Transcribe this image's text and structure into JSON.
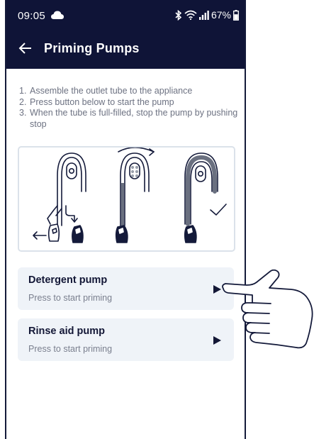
{
  "status_bar": {
    "time": "09:05",
    "battery": "67%",
    "icons": [
      "cloud-icon",
      "bluetooth-icon",
      "wifi-icon",
      "signal-icon",
      "battery-icon"
    ]
  },
  "header": {
    "title": "Priming Pumps",
    "back_icon": "back-arrow-icon"
  },
  "instructions": [
    {
      "num": "1.",
      "text": "Assemble the outlet tube to the appliance"
    },
    {
      "num": "2.",
      "text": "Press button below to start the pump"
    },
    {
      "num": "3.",
      "text": "When the tube is full-filled, stop the pump by pushing stop"
    }
  ],
  "pumps": [
    {
      "title": "Detergent pump",
      "subtitle": "Press to start priming",
      "action_icon": "play-icon"
    },
    {
      "title": "Rinse aid pump",
      "subtitle": "Press to start priming",
      "action_icon": "play-icon"
    }
  ],
  "colors": {
    "header_bg": "#0f1437",
    "card_bg": "#eff3f8",
    "accent_dark": "#131736",
    "muted_text": "#6d7282"
  }
}
